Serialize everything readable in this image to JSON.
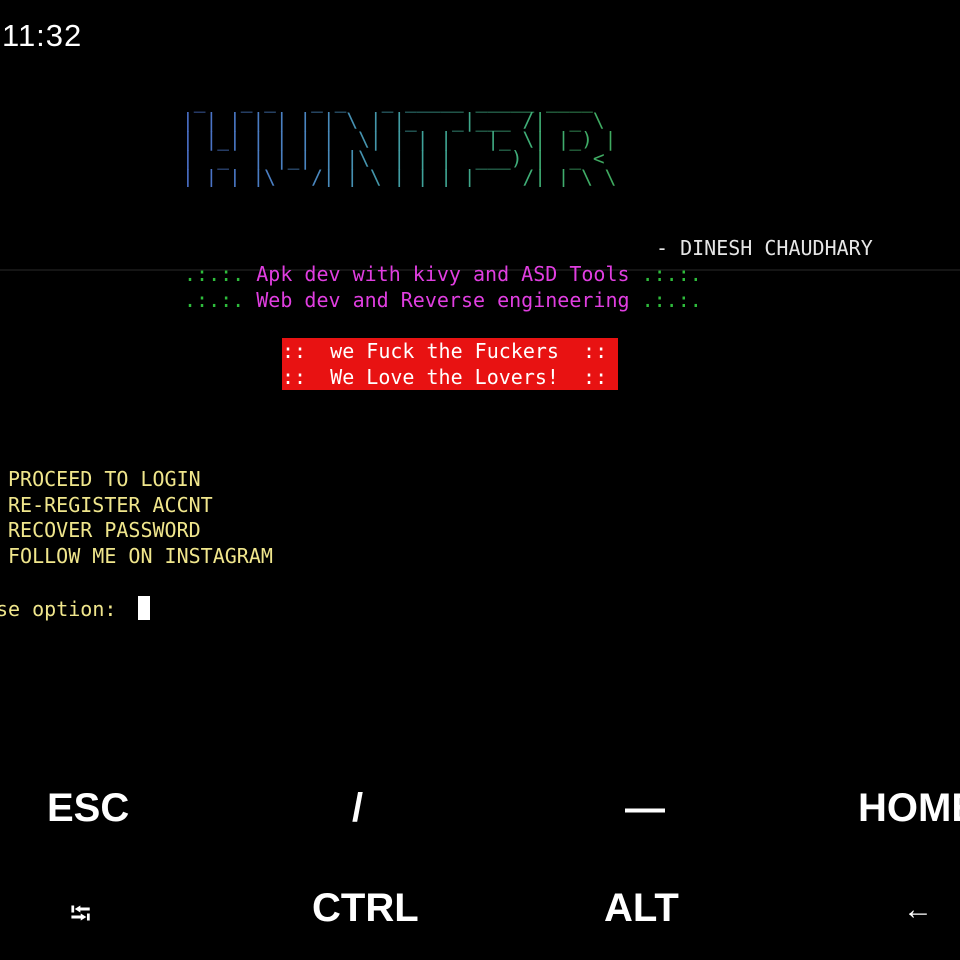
{
  "status": {
    "time": "11:32"
  },
  "banner": {
    "art": " _   _ _   _ _   _ _____ _____ ____  \n| | | | | | | \\ | |_   _|___ /|  _ \\ \n| |_| | | | |  \\| | | |   |_ \\| |_) |\n|  _  | |_| | |\\  | | |  ___) |  _ < \n|_| |_|\\___/|_| \\_| |_| |____/|_| \\_\\",
    "author": "- DINESH CHAUDHARY"
  },
  "taglines": [
    {
      "prefix": ".:.:. ",
      "text": "Apk dev with kivy and ASD Tools",
      "suffix": " .:.:."
    },
    {
      "prefix": ".:.:. ",
      "text": "Web dev and Reverse engineering",
      "suffix": " .:.:."
    }
  ],
  "slogans": [
    "::  we Fuck the Fuckers  ::",
    "::  We Love the Lovers!  ::"
  ],
  "menu": [
    "PROCEED TO LOGIN",
    "RE-REGISTER ACCNT",
    "RECOVER PASSWORD",
    "FOLLOW ME ON INSTAGRAM"
  ],
  "prompt": {
    "text": "se option: "
  },
  "extra_keys": {
    "row1": [
      "ESC",
      "/",
      "—",
      "HOME"
    ],
    "row2": [
      "⭾",
      "CTRL",
      "ALT",
      "←"
    ]
  },
  "colors": {
    "background": "#000000",
    "menu_text": "#f0e68c",
    "tagline_dots": "#2ebd3c",
    "tagline_text": "#e03ee0",
    "slogan_bg": "#e81212"
  }
}
